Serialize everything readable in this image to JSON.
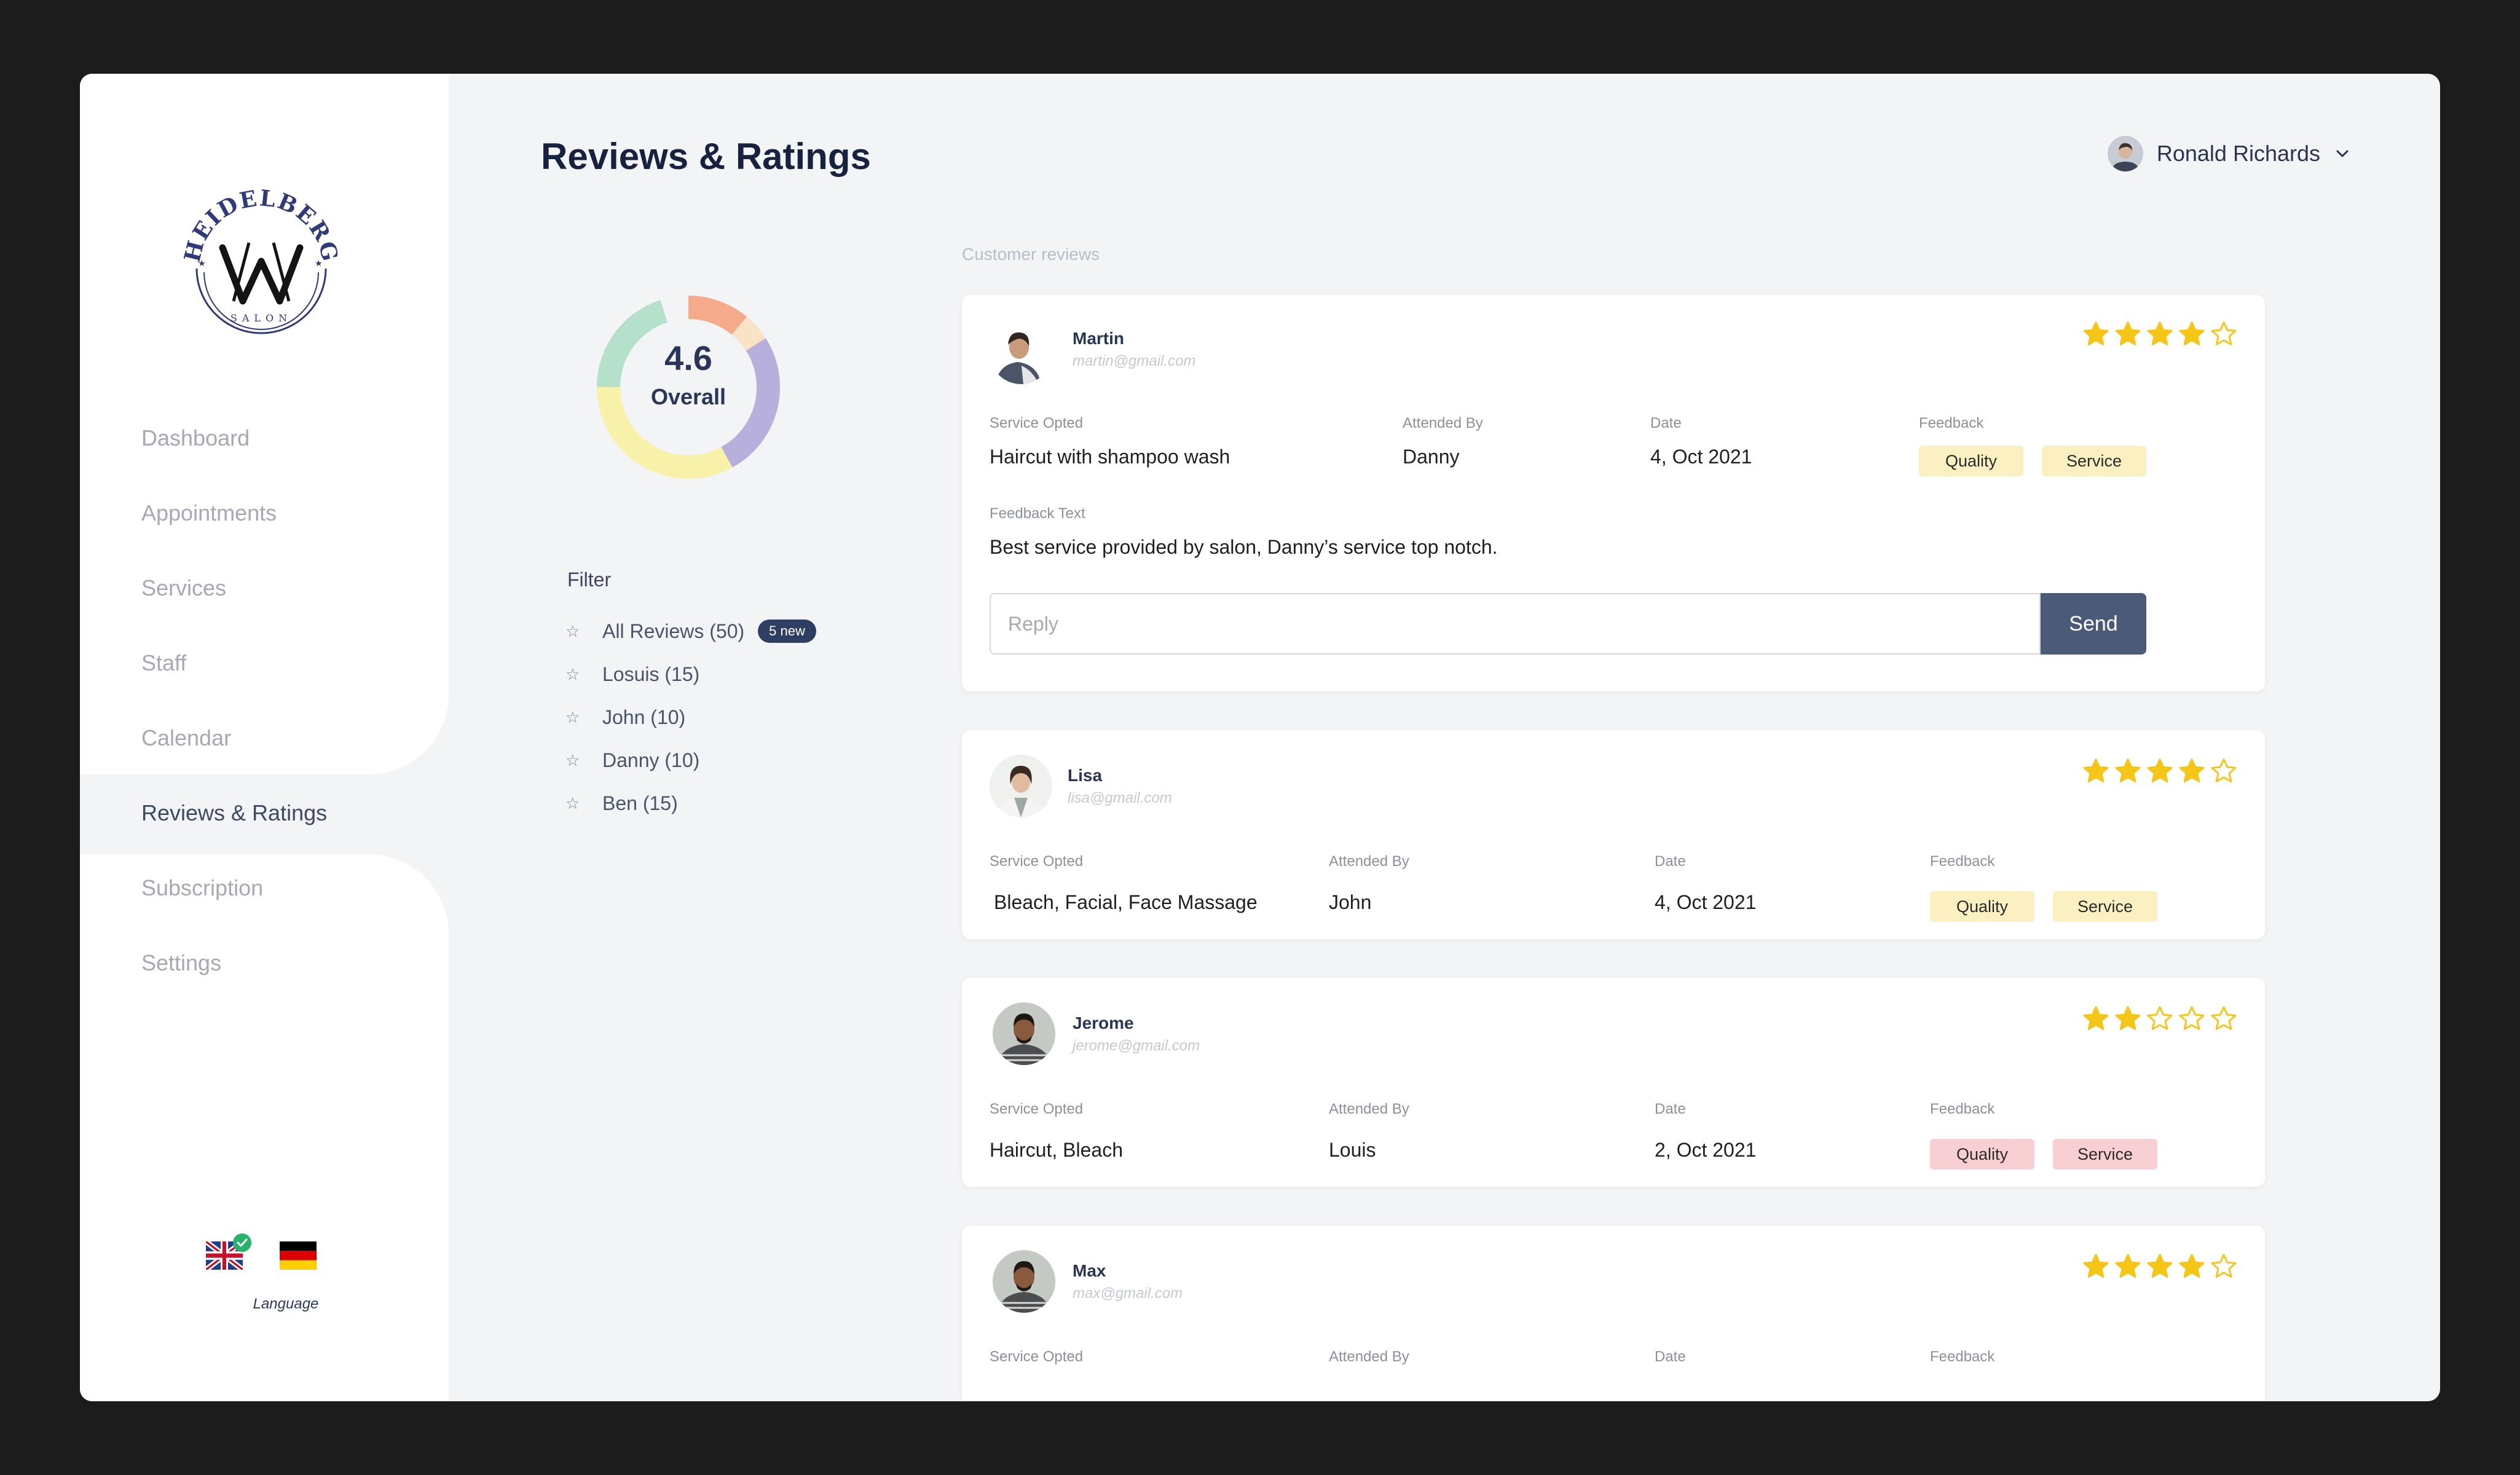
{
  "page": {
    "title": "Reviews & Ratings"
  },
  "brand": {
    "logo_text": "HEIDELBERG",
    "logo_sub": "SALON"
  },
  "sidebar": {
    "items": [
      {
        "label": "Dashboard"
      },
      {
        "label": "Appointments"
      },
      {
        "label": "Services"
      },
      {
        "label": "Staff"
      },
      {
        "label": "Calendar"
      },
      {
        "label": "Reviews & Ratings",
        "active": true
      },
      {
        "label": "Subscription"
      },
      {
        "label": "Settings"
      }
    ],
    "language": {
      "label": "Language",
      "options": [
        "English",
        "German"
      ],
      "selected": "English"
    }
  },
  "header": {
    "user_name": "Ronald Richards",
    "chevron_icon": "chevron-down-icon"
  },
  "overall": {
    "value": "4.6",
    "label": "Overall",
    "segments": [
      {
        "color": "#f4aa8b",
        "fraction": 0.11
      },
      {
        "color": "#f9e3c6",
        "fraction": 0.05
      },
      {
        "color": "#b7b0dc",
        "fraction": 0.26
      },
      {
        "color": "#f8f1a9",
        "fraction": 0.33
      },
      {
        "color": "#b5e0cb",
        "fraction": 0.2
      }
    ]
  },
  "filter": {
    "title": "Filter",
    "items": [
      {
        "label": "All Reviews (50)",
        "badge": "5 new"
      },
      {
        "label": "Losuis (15)"
      },
      {
        "label": "John (10)"
      },
      {
        "label": "Danny (10)"
      },
      {
        "label": "Ben (15)"
      }
    ]
  },
  "reviews": {
    "section_label": "Customer reviews",
    "labels": {
      "service": "Service Opted",
      "attended": "Attended By",
      "date": "Date",
      "feedback": "Feedback",
      "feedback_text": "Feedback Text"
    },
    "items": [
      {
        "name": "Martin",
        "email": "martin@gmail.com",
        "rating": 4,
        "service": "Haircut with shampoo wash",
        "attended_by": "Danny",
        "date": "4, Oct 2021",
        "tags": [
          "Quality",
          "Service"
        ],
        "tag_color": "#fbf0c2",
        "feedback_text": "Best service provided by salon, Danny’s service top notch.",
        "reply_placeholder": "Reply",
        "send_label": "Send"
      },
      {
        "name": "Lisa",
        "email": "lisa@gmail.com",
        "rating": 4,
        "service": "Bleach, Facial, Face Massage",
        "attended_by": "John",
        "date": "4, Oct 2021",
        "tags": [
          "Quality",
          "Service"
        ],
        "tag_color": "#fbf0c2"
      },
      {
        "name": "Jerome",
        "email": "jerome@gmail.com",
        "rating": 2,
        "service": "Haircut, Bleach",
        "attended_by": "Louis",
        "date": "2, Oct 2021",
        "tags": [
          "Quality",
          "Service"
        ],
        "tag_color": "#f8d0d3"
      },
      {
        "name": "Max",
        "email": "max@gmail.com",
        "rating": 4
      }
    ]
  }
}
